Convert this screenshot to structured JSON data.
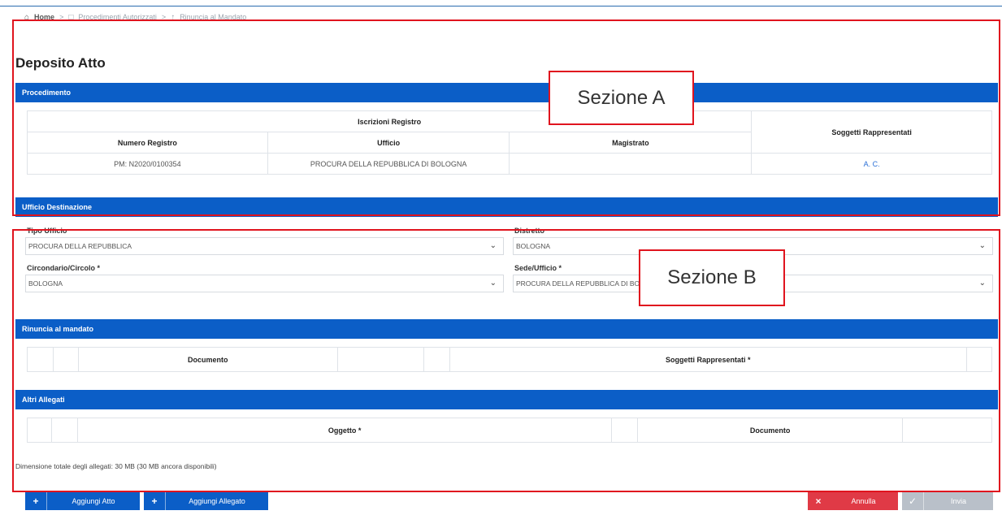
{
  "breadcrumb": {
    "home": "Home",
    "item1": "Procedimenti Autorizzati",
    "item2": "Rinuncia al Mandato"
  },
  "page_title": "Deposito Atto",
  "procedimento": {
    "title": "Procedimento",
    "group_header": "Iscrizioni Registro",
    "columns": [
      "Numero Registro",
      "Ufficio",
      "Magistrato",
      "Soggetti Rappresentati"
    ],
    "row": [
      "PM: N2020/0100354",
      "PROCURA DELLA REPUBBLICA DI BOLOGNA",
      "",
      "A. C."
    ]
  },
  "ufficio_destinazione": {
    "title": "Ufficio Destinazione",
    "tipo_ufficio_label": "Tipo Ufficio",
    "tipo_ufficio_value": "PROCURA DELLA REPUBBLICA",
    "distretto_label": "Distretto",
    "distretto_value": "BOLOGNA",
    "circondario_label": "Circondario/Circolo *",
    "circondario_value": "BOLOGNA",
    "sede_label": "Sede/Ufficio *",
    "sede_value": "PROCURA DELLA REPUBBLICA DI BOLOGNA"
  },
  "rinuncia": {
    "title": "Rinuncia al mandato",
    "col_documento": "Documento",
    "col_soggetti": "Soggetti Rappresentati *"
  },
  "altri_allegati": {
    "title": "Altri Allegati",
    "col_oggetto": "Oggetto *",
    "col_documento": "Documento"
  },
  "info_text": "Dimensione totale degli allegati: 30 MB (30 MB ancora disponibili)",
  "buttons": {
    "aggiungi_atto": "Aggiungi Atto",
    "aggiungi_allegato": "Aggiungi Allegato",
    "annulla": "Annulla",
    "invia": "Invia"
  },
  "annotations": {
    "section_a": "Sezione A",
    "section_b": "Sezione B"
  },
  "colors": {
    "primary": "#0b5ec7",
    "danger": "#e03a46",
    "disabled": "#b9c0c9",
    "annotation": "#e0141e"
  }
}
